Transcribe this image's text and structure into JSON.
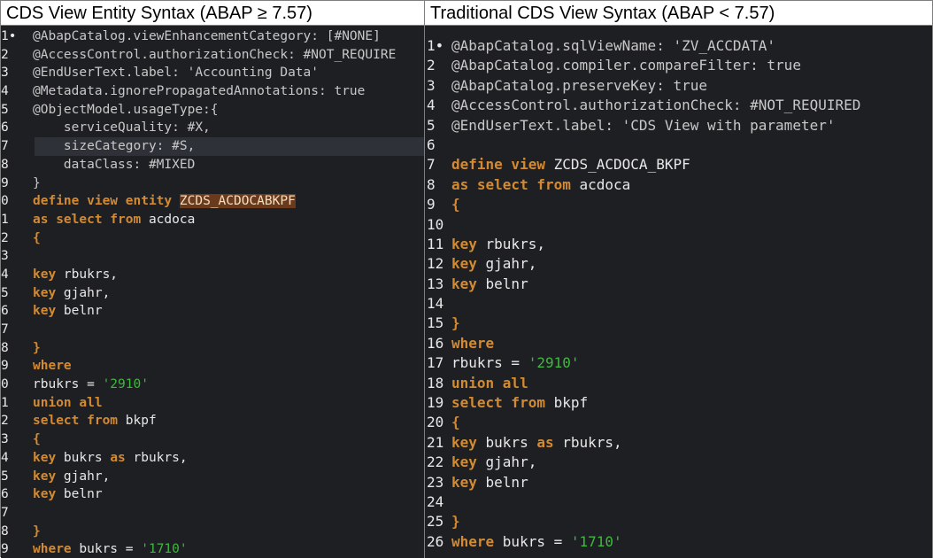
{
  "panels": [
    {
      "id": "new",
      "title": "CDS View Entity Syntax (ABAP ≥ 7.57)",
      "lines": [
        {
          "n": "1•",
          "hl": false,
          "tokens": [
            {
              "t": "@AbapCatalog.viewEnhancementCategory: [#NONE]",
              "c": "anno"
            }
          ]
        },
        {
          "n": "2",
          "hl": false,
          "tokens": [
            {
              "t": "@AccessControl.authorizationCheck: #NOT_REQUIRE",
              "c": "anno"
            }
          ]
        },
        {
          "n": "3",
          "hl": false,
          "tokens": [
            {
              "t": "@EndUserText.label: 'Accounting Data'",
              "c": "anno"
            }
          ]
        },
        {
          "n": "4",
          "hl": false,
          "tokens": [
            {
              "t": "@Metadata.ignorePropagatedAnnotations: true",
              "c": "anno"
            }
          ]
        },
        {
          "n": "5",
          "hl": false,
          "tokens": [
            {
              "t": "@ObjectModel.usageType:{",
              "c": "anno"
            }
          ]
        },
        {
          "n": "6",
          "hl": false,
          "tokens": [
            {
              "t": "    serviceQuality: #X,",
              "c": "anno"
            }
          ]
        },
        {
          "n": "7",
          "hl": true,
          "tokens": [
            {
              "t": "    sizeCategory: #S,",
              "c": "anno"
            }
          ]
        },
        {
          "n": "8",
          "hl": false,
          "tokens": [
            {
              "t": "    dataClass: #MIXED",
              "c": "anno"
            }
          ]
        },
        {
          "n": "9",
          "hl": false,
          "tokens": [
            {
              "t": "}",
              "c": "anno"
            }
          ]
        },
        {
          "n": "0",
          "hl": false,
          "tokens": [
            {
              "t": "define view entity ",
              "c": "kw"
            },
            {
              "t": "ZCDS_ACDOCABKPF",
              "c": "hl"
            }
          ]
        },
        {
          "n": "1",
          "hl": false,
          "tokens": [
            {
              "t": "as select from ",
              "c": "kw"
            },
            {
              "t": "acdoca",
              "c": "plain"
            }
          ]
        },
        {
          "n": "2",
          "hl": false,
          "tokens": [
            {
              "t": "{",
              "c": "kw"
            }
          ]
        },
        {
          "n": "3",
          "hl": false,
          "tokens": []
        },
        {
          "n": "4",
          "hl": false,
          "tokens": [
            {
              "t": "key ",
              "c": "kw"
            },
            {
              "t": "rbukrs,",
              "c": "plain"
            }
          ]
        },
        {
          "n": "5",
          "hl": false,
          "tokens": [
            {
              "t": "key ",
              "c": "kw"
            },
            {
              "t": "gjahr,",
              "c": "plain"
            }
          ]
        },
        {
          "n": "6",
          "hl": false,
          "tokens": [
            {
              "t": "key ",
              "c": "kw"
            },
            {
              "t": "belnr",
              "c": "plain"
            }
          ]
        },
        {
          "n": "7",
          "hl": false,
          "tokens": []
        },
        {
          "n": "8",
          "hl": false,
          "tokens": [
            {
              "t": "}",
              "c": "kw"
            }
          ]
        },
        {
          "n": "9",
          "hl": false,
          "tokens": [
            {
              "t": "where",
              "c": "kw"
            }
          ]
        },
        {
          "n": "0",
          "hl": false,
          "tokens": [
            {
              "t": "rbukrs = ",
              "c": "plain"
            },
            {
              "t": "'2910'",
              "c": "str"
            }
          ]
        },
        {
          "n": "1",
          "hl": false,
          "tokens": [
            {
              "t": "union all",
              "c": "kw"
            }
          ]
        },
        {
          "n": "2",
          "hl": false,
          "tokens": [
            {
              "t": "select from ",
              "c": "kw"
            },
            {
              "t": "bkpf",
              "c": "plain"
            }
          ]
        },
        {
          "n": "3",
          "hl": false,
          "tokens": [
            {
              "t": "{",
              "c": "kw"
            }
          ]
        },
        {
          "n": "4",
          "hl": false,
          "tokens": [
            {
              "t": "key ",
              "c": "kw"
            },
            {
              "t": "bukrs ",
              "c": "plain"
            },
            {
              "t": "as ",
              "c": "kw"
            },
            {
              "t": "rbukrs,",
              "c": "plain"
            }
          ]
        },
        {
          "n": "5",
          "hl": false,
          "tokens": [
            {
              "t": "key ",
              "c": "kw"
            },
            {
              "t": "gjahr,",
              "c": "plain"
            }
          ]
        },
        {
          "n": "6",
          "hl": false,
          "tokens": [
            {
              "t": "key ",
              "c": "kw"
            },
            {
              "t": "belnr",
              "c": "plain"
            }
          ]
        },
        {
          "n": "7",
          "hl": false,
          "tokens": []
        },
        {
          "n": "8",
          "hl": false,
          "tokens": [
            {
              "t": "}",
              "c": "kw"
            }
          ]
        },
        {
          "n": "9",
          "hl": false,
          "tokens": [
            {
              "t": "where ",
              "c": "kw"
            },
            {
              "t": "bukrs = ",
              "c": "plain"
            },
            {
              "t": "'1710'",
              "c": "str"
            }
          ]
        }
      ]
    },
    {
      "id": "traditional",
      "title": "Traditional CDS View Syntax (ABAP < 7.57)",
      "lines": [
        {
          "n": "1•",
          "hl": false,
          "tokens": [
            {
              "t": "@AbapCatalog.sqlViewName: 'ZV_ACCDATA'",
              "c": "anno"
            }
          ]
        },
        {
          "n": "2",
          "hl": false,
          "tokens": [
            {
              "t": "@AbapCatalog.compiler.compareFilter: true",
              "c": "anno"
            }
          ]
        },
        {
          "n": "3",
          "hl": false,
          "tokens": [
            {
              "t": "@AbapCatalog.preserveKey: true",
              "c": "anno"
            }
          ]
        },
        {
          "n": "4",
          "hl": false,
          "tokens": [
            {
              "t": "@AccessControl.authorizationCheck: #NOT_REQUIRED",
              "c": "anno"
            }
          ]
        },
        {
          "n": "5",
          "hl": false,
          "tokens": [
            {
              "t": "@EndUserText.label: 'CDS View with parameter'",
              "c": "anno"
            }
          ]
        },
        {
          "n": "6",
          "hl": false,
          "tokens": []
        },
        {
          "n": "7",
          "hl": false,
          "tokens": [
            {
              "t": "define view ",
              "c": "kw"
            },
            {
              "t": "ZCDS_ACDOCA_BKPF",
              "c": "plain"
            }
          ]
        },
        {
          "n": "8",
          "hl": false,
          "tokens": [
            {
              "t": "as select from ",
              "c": "kw"
            },
            {
              "t": "acdoca",
              "c": "plain"
            }
          ]
        },
        {
          "n": "9",
          "hl": false,
          "tokens": [
            {
              "t": "{",
              "c": "kw"
            }
          ]
        },
        {
          "n": "10",
          "hl": false,
          "tokens": []
        },
        {
          "n": "11",
          "hl": false,
          "tokens": [
            {
              "t": "key ",
              "c": "kw"
            },
            {
              "t": "rbukrs,",
              "c": "plain"
            }
          ]
        },
        {
          "n": "12",
          "hl": false,
          "tokens": [
            {
              "t": "key ",
              "c": "kw"
            },
            {
              "t": "gjahr,",
              "c": "plain"
            }
          ]
        },
        {
          "n": "13",
          "hl": false,
          "tokens": [
            {
              "t": "key ",
              "c": "kw"
            },
            {
              "t": "belnr",
              "c": "plain"
            }
          ]
        },
        {
          "n": "14",
          "hl": false,
          "tokens": []
        },
        {
          "n": "15",
          "hl": false,
          "tokens": [
            {
              "t": "}",
              "c": "kw"
            }
          ]
        },
        {
          "n": "16",
          "hl": false,
          "tokens": [
            {
              "t": "where",
              "c": "kw"
            }
          ]
        },
        {
          "n": "17",
          "hl": false,
          "tokens": [
            {
              "t": "rbukrs = ",
              "c": "plain"
            },
            {
              "t": "'2910'",
              "c": "str"
            }
          ]
        },
        {
          "n": "18",
          "hl": false,
          "tokens": [
            {
              "t": "union all",
              "c": "kw"
            }
          ]
        },
        {
          "n": "19",
          "hl": false,
          "tokens": [
            {
              "t": "select from ",
              "c": "kw"
            },
            {
              "t": "bkpf",
              "c": "plain"
            }
          ]
        },
        {
          "n": "20",
          "hl": false,
          "tokens": [
            {
              "t": "{",
              "c": "kw"
            }
          ]
        },
        {
          "n": "21",
          "hl": false,
          "tokens": [
            {
              "t": "key ",
              "c": "kw"
            },
            {
              "t": "bukrs ",
              "c": "plain"
            },
            {
              "t": "as ",
              "c": "kw"
            },
            {
              "t": "rbukrs,",
              "c": "plain"
            }
          ]
        },
        {
          "n": "22",
          "hl": false,
          "tokens": [
            {
              "t": "key ",
              "c": "kw"
            },
            {
              "t": "gjahr,",
              "c": "plain"
            }
          ]
        },
        {
          "n": "23",
          "hl": false,
          "tokens": [
            {
              "t": "key ",
              "c": "kw"
            },
            {
              "t": "belnr",
              "c": "plain"
            }
          ]
        },
        {
          "n": "24",
          "hl": false,
          "tokens": []
        },
        {
          "n": "25",
          "hl": false,
          "tokens": [
            {
              "t": "}",
              "c": "kw"
            }
          ]
        },
        {
          "n": "26",
          "hl": false,
          "tokens": [
            {
              "t": "where ",
              "c": "kw"
            },
            {
              "t": "bukrs = ",
              "c": "plain"
            },
            {
              "t": "'1710'",
              "c": "str"
            }
          ]
        }
      ]
    }
  ],
  "colors": {
    "editor_bg": "#1e1f22",
    "keyword": "#d38a31",
    "string": "#3fb83f",
    "annotation": "#c8c8c8",
    "identifier_highlight": "#6b3a1c"
  }
}
